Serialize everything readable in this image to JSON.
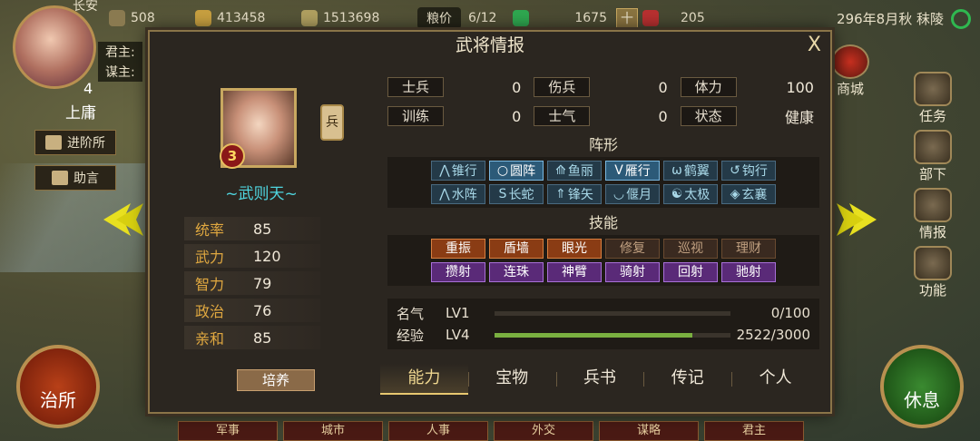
{
  "topbar": {
    "city_label": "长安",
    "res1": "508",
    "res2": "413458",
    "res3": "1513698",
    "grain_label": "粮价",
    "grain_value": "6/12",
    "res4": "1675",
    "res4_add": "十",
    "res5": "205",
    "date": "296年8月秋 秣陵"
  },
  "player": {
    "lord_label": "君主:",
    "advisor_label": "谋主:",
    "level": "4",
    "rank": "上庸",
    "promote_btn": "进阶所",
    "advice_btn": "助言"
  },
  "left_round_btn": "治所",
  "right_round_btn": "休息",
  "right_menu": [
    "商城",
    "任务",
    "部下",
    "情报",
    "功能"
  ],
  "bottom_tabs": [
    "军事",
    "城市",
    "人事",
    "外交",
    "谋略",
    "君主"
  ],
  "panel": {
    "title": "武将情报",
    "close": "X",
    "general": {
      "level_badge": "3",
      "type_badge": "兵",
      "name": "~武则天~",
      "stats": [
        {
          "k": "统率",
          "v": "85"
        },
        {
          "k": "武力",
          "v": "120"
        },
        {
          "k": "智力",
          "v": "79"
        },
        {
          "k": "政治",
          "v": "76"
        },
        {
          "k": "亲和",
          "v": "85"
        }
      ],
      "train_btn": "培养"
    },
    "status": [
      [
        {
          "k": "士兵",
          "v": "0"
        },
        {
          "k": "伤兵",
          "v": "0"
        },
        {
          "k": "体力",
          "v": "100"
        }
      ],
      [
        {
          "k": "训练",
          "v": "0"
        },
        {
          "k": "士气",
          "v": "0"
        },
        {
          "k": "状态",
          "v": "健康"
        }
      ]
    ],
    "formation_title": "阵形",
    "formations": [
      {
        "icon": "⋀",
        "label": "锥行",
        "active": false
      },
      {
        "icon": "○",
        "label": "圆阵",
        "active": true
      },
      {
        "icon": "⟰",
        "label": "鱼丽",
        "active": false
      },
      {
        "icon": "V",
        "label": "雁行",
        "active": true
      },
      {
        "icon": "ω",
        "label": "鹤翼",
        "active": false
      },
      {
        "icon": "↺",
        "label": "钩行",
        "active": false
      },
      {
        "icon": "⋀",
        "label": "水阵",
        "active": false
      },
      {
        "icon": "S",
        "label": "长蛇",
        "active": false
      },
      {
        "icon": "⇑",
        "label": "锋矢",
        "active": false
      },
      {
        "icon": "◡",
        "label": "偃月",
        "active": false
      },
      {
        "icon": "☯",
        "label": "太极",
        "active": false
      },
      {
        "icon": "◈",
        "label": "玄襄",
        "active": false
      }
    ],
    "skill_title": "技能",
    "skills": [
      {
        "label": "重振",
        "style": "orange"
      },
      {
        "label": "盾墙",
        "style": "orange"
      },
      {
        "label": "眼光",
        "style": "orange"
      },
      {
        "label": "修复",
        "style": "dim"
      },
      {
        "label": "巡视",
        "style": "dim"
      },
      {
        "label": "理财",
        "style": "dim"
      },
      {
        "label": "攒射",
        "style": "purple"
      },
      {
        "label": "连珠",
        "style": "purple"
      },
      {
        "label": "神臂",
        "style": "purple"
      },
      {
        "label": "骑射",
        "style": "purple"
      },
      {
        "label": "回射",
        "style": "purple"
      },
      {
        "label": "驰射",
        "style": "purple"
      }
    ],
    "fame": {
      "k": "名气",
      "lv": "LV1",
      "num": "0/100",
      "progress": 0
    },
    "exp": {
      "k": "经验",
      "lv": "LV4",
      "num": "2522/3000",
      "progress": 0.84
    },
    "tabs": [
      "能力",
      "宝物",
      "兵书",
      "传记",
      "个人"
    ],
    "active_tab": 0
  },
  "colors": {
    "accent_gold": "#e8c870",
    "name_cyan": "#4fd6e0",
    "stat_key": "#e0a840",
    "exp_bar": "#7ab040"
  }
}
